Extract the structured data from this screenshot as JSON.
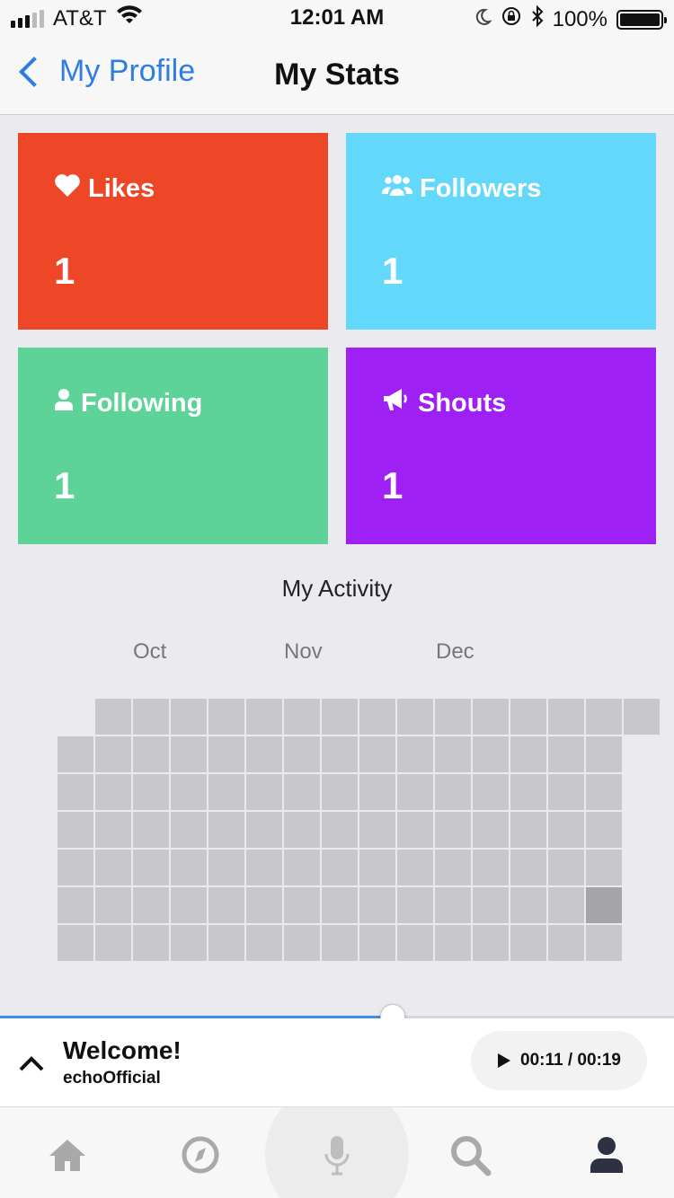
{
  "status_bar": {
    "carrier": "AT&T",
    "time": "12:01 AM",
    "battery": "100%"
  },
  "nav": {
    "back_label": "My Profile",
    "title": "My Stats"
  },
  "stats": [
    {
      "label": "Likes",
      "value": "1",
      "color": "#ed4727",
      "icon": "heart-icon"
    },
    {
      "label": "Followers",
      "value": "1",
      "color": "#64d8fa",
      "icon": "users-icon"
    },
    {
      "label": "Following",
      "value": "1",
      "color": "#5dd397",
      "icon": "user-icon"
    },
    {
      "label": "Shouts",
      "value": "1",
      "color": "#9f20f5",
      "icon": "megaphone-icon"
    }
  ],
  "activity": {
    "title": "My Activity",
    "months": [
      "Oct",
      "Nov",
      "Dec"
    ],
    "weeks": 16,
    "days": 7,
    "first_week_start_day": 1,
    "last_week_end_day": 6,
    "active_cells": [
      {
        "week": 14,
        "day": 5
      }
    ]
  },
  "player": {
    "title": "Welcome!",
    "artist": "echoOfficial",
    "time": "00:11 / 00:19",
    "progress": 0.58
  },
  "tabs": [
    {
      "name": "home",
      "icon": "home-icon"
    },
    {
      "name": "discover",
      "icon": "compass-icon"
    },
    {
      "name": "record",
      "icon": "microphone-icon"
    },
    {
      "name": "search",
      "icon": "search-icon"
    },
    {
      "name": "profile",
      "icon": "profile-icon"
    }
  ],
  "colors": {
    "accent": "#2f7de1",
    "cell_empty": "#c8c7cc",
    "cell_active": "#a5a5a8"
  }
}
